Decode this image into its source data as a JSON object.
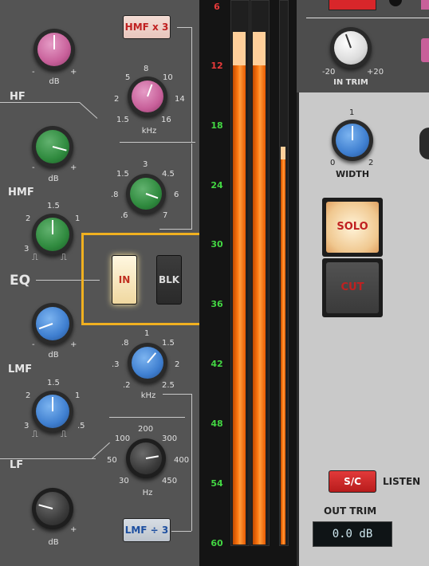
{
  "colors": {
    "accent_orange": "#f0b020",
    "meter_orange": "#ff7a12",
    "green_tick": "#43d643",
    "red_tick": "#e83a3a",
    "pink_knob": "#c8609a",
    "green_knob": "#2f8a3e",
    "blue_knob": "#3f7fd0"
  },
  "eq": {
    "section_label": "EQ",
    "hf": {
      "label": "HF",
      "gain_unit": "dB",
      "freq_unit": "kHz",
      "freq_ticks": [
        "8",
        "5",
        "10",
        "2",
        "14",
        "1.5",
        "16"
      ]
    },
    "hmf": {
      "label": "HMF",
      "gain_unit": "dB",
      "freq_unit": "kHz",
      "freq_ticks": [
        "3",
        "1.5",
        "4.5",
        ".8",
        "6",
        ".6",
        "7"
      ],
      "q_ticks": [
        "1.5",
        "2",
        "1",
        "3"
      ]
    },
    "lmf": {
      "label": "LMF",
      "gain_unit": "dB",
      "freq_unit": "kHz",
      "freq_ticks": [
        "1",
        ".8",
        "1.5",
        ".3",
        "2",
        ".2",
        "2.5"
      ],
      "q_ticks": [
        "1.5",
        "2",
        "1",
        "3",
        ".5"
      ]
    },
    "lf": {
      "label": "LF",
      "gain_unit": "dB",
      "freq_unit": "Hz",
      "freq_ticks": [
        "200",
        "100",
        "300",
        "50",
        "400",
        "30",
        "450"
      ]
    },
    "hmf_x3_label": "HMF x 3",
    "lmf_div3_label": "LMF ÷ 3",
    "in_label": "IN",
    "blk_label": "BLK",
    "minus": "-",
    "plus": "+"
  },
  "meter": {
    "ticks": [
      "6",
      "12",
      "18",
      "24",
      "30",
      "36",
      "42",
      "48",
      "54",
      "60"
    ]
  },
  "right": {
    "in_trim": {
      "label": "IN TRIM",
      "min": "-20",
      "max": "+20"
    },
    "width": {
      "label": "WIDTH",
      "min": "0",
      "mid": "1",
      "max": "2"
    },
    "solo_label": "SOLO",
    "cut_label": "CUT",
    "sc_label": "S/C",
    "listen_label": "LISTEN",
    "out_trim": {
      "label": "OUT TRIM",
      "value": "0.0 dB"
    }
  }
}
